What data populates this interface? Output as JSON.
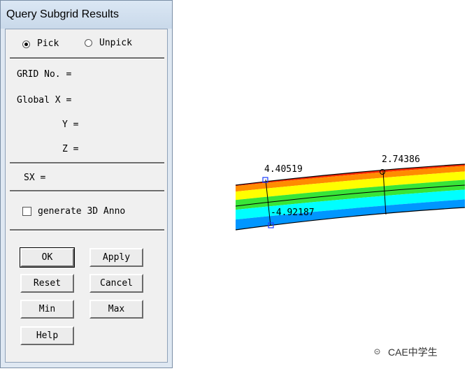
{
  "dialog": {
    "title": "Query Subgrid Results",
    "pick_label": "Pick",
    "unpick_label": "Unpick",
    "grid_no_label": "GRID No. =",
    "global_x_label": "Global X =",
    "y_label": "Y =",
    "z_label": "Z =",
    "sx_label": "SX =",
    "generate_anno_label": "generate 3D Anno",
    "buttons": {
      "ok": "OK",
      "apply": "Apply",
      "reset": "Reset",
      "cancel": "Cancel",
      "min": "Min",
      "max": "Max",
      "help": "Help"
    }
  },
  "plot": {
    "label_1": "4.40519",
    "label_2": "2.74386",
    "label_3": "-4.92187"
  },
  "watermark": "CAE中学生",
  "colors": {
    "red": "#ff2a00",
    "orange": "#ff8c00",
    "yellow": "#ffff00",
    "green": "#38e538",
    "cyan": "#00ffff",
    "blue": "#0096ff"
  }
}
